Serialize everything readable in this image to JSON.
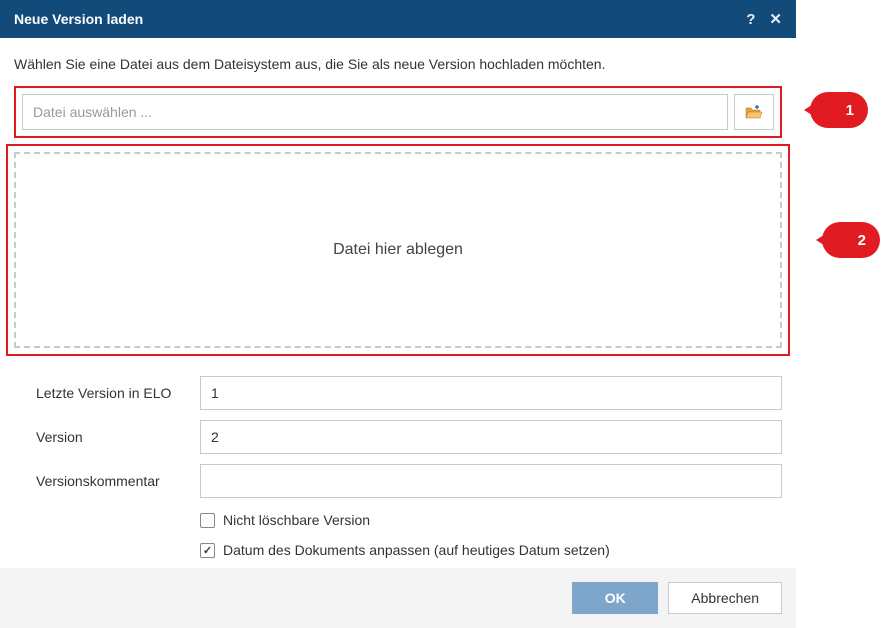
{
  "title": "Neue Version laden",
  "instruction": "Wählen Sie eine Datei aus dem Dateisystem aus, die Sie als neue Version hochladen möchten.",
  "file": {
    "placeholder": "Datei auswählen ..."
  },
  "dropzone": {
    "label": "Datei hier ablegen"
  },
  "form": {
    "lastVersionLabel": "Letzte Version in ELO",
    "lastVersionValue": "1",
    "versionLabel": "Version",
    "versionValue": "2",
    "commentLabel": "Versionskommentar",
    "commentValue": "",
    "cb1Label": "Nicht löschbare Version",
    "cb2Label": "Datum des Dokuments anpassen (auf heutiges Datum setzen)"
  },
  "buttons": {
    "ok": "OK",
    "cancel": "Abbrechen"
  },
  "callouts": {
    "one": "1",
    "two": "2"
  }
}
